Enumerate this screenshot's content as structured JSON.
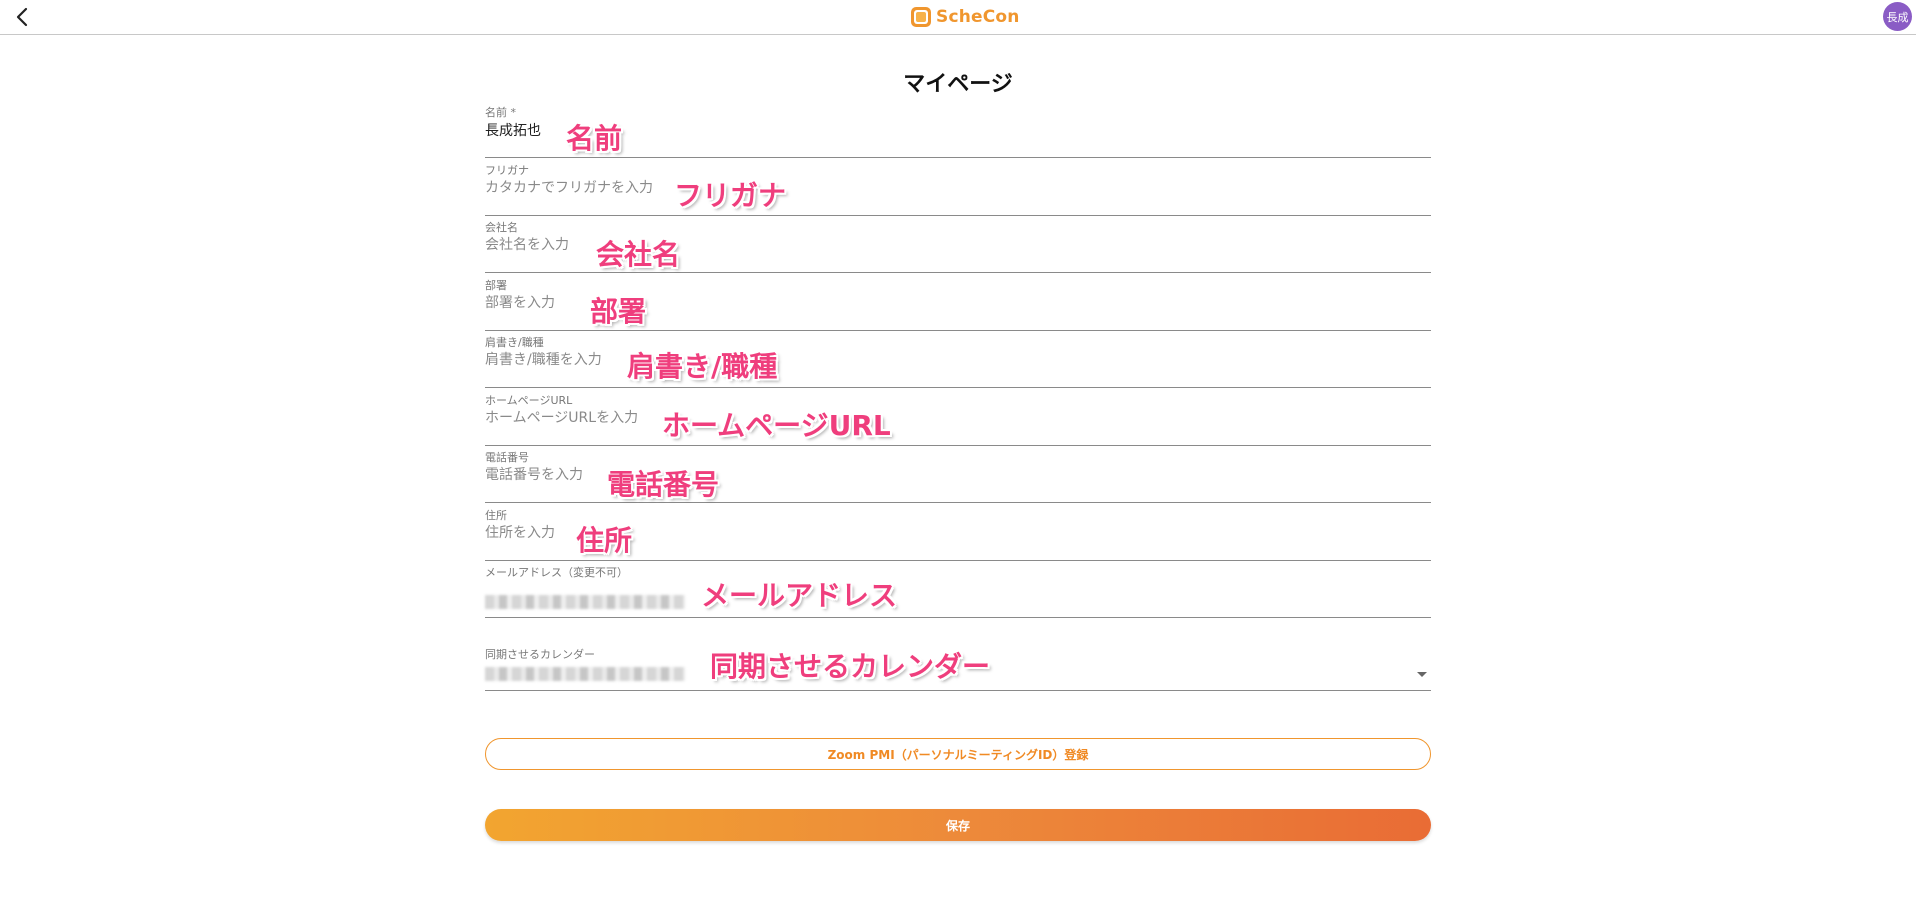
{
  "header": {
    "logo_text": "ScheCon",
    "avatar_text": "長成",
    "accent": "#f0962e",
    "avatar_color": "#8a5cc5",
    "back_icon": "chevron-left-icon"
  },
  "page_title": "マイページ",
  "fields": [
    {
      "label": "名前 *",
      "value": "長成拓也",
      "placeholder": "",
      "annotation": "名前"
    },
    {
      "label": "フリガナ",
      "value": "",
      "placeholder": "カタカナでフリガナを入力",
      "annotation": "フリガナ"
    },
    {
      "label": "会社名",
      "value": "",
      "placeholder": "会社名を入力",
      "annotation": "会社名"
    },
    {
      "label": "部署",
      "value": "",
      "placeholder": "部署を入力",
      "annotation": "部署"
    },
    {
      "label": "肩書き/職種",
      "value": "",
      "placeholder": "肩書き/職種を入力",
      "annotation": "肩書き/職種"
    },
    {
      "label": "ホームページURL",
      "value": "",
      "placeholder": "ホームページURLを入力",
      "annotation": "ホームページURL"
    },
    {
      "label": "電話番号",
      "value": "",
      "placeholder": "電話番号を入力",
      "annotation": "電話番号"
    },
    {
      "label": "住所",
      "value": "",
      "placeholder": "住所を入力",
      "annotation": "住所"
    },
    {
      "label": "メールアドレス（変更不可）",
      "value": "",
      "placeholder": "",
      "annotation": "メールアドレス"
    }
  ],
  "calendar_select": {
    "label": "同期させるカレンダー",
    "annotation": "同期させるカレンダー"
  },
  "buttons": {
    "zoom_label": "Zoom PMI（パーソナルミーティングID）登録",
    "save_label": "保存"
  },
  "annotation_color": "#ef3e7d"
}
